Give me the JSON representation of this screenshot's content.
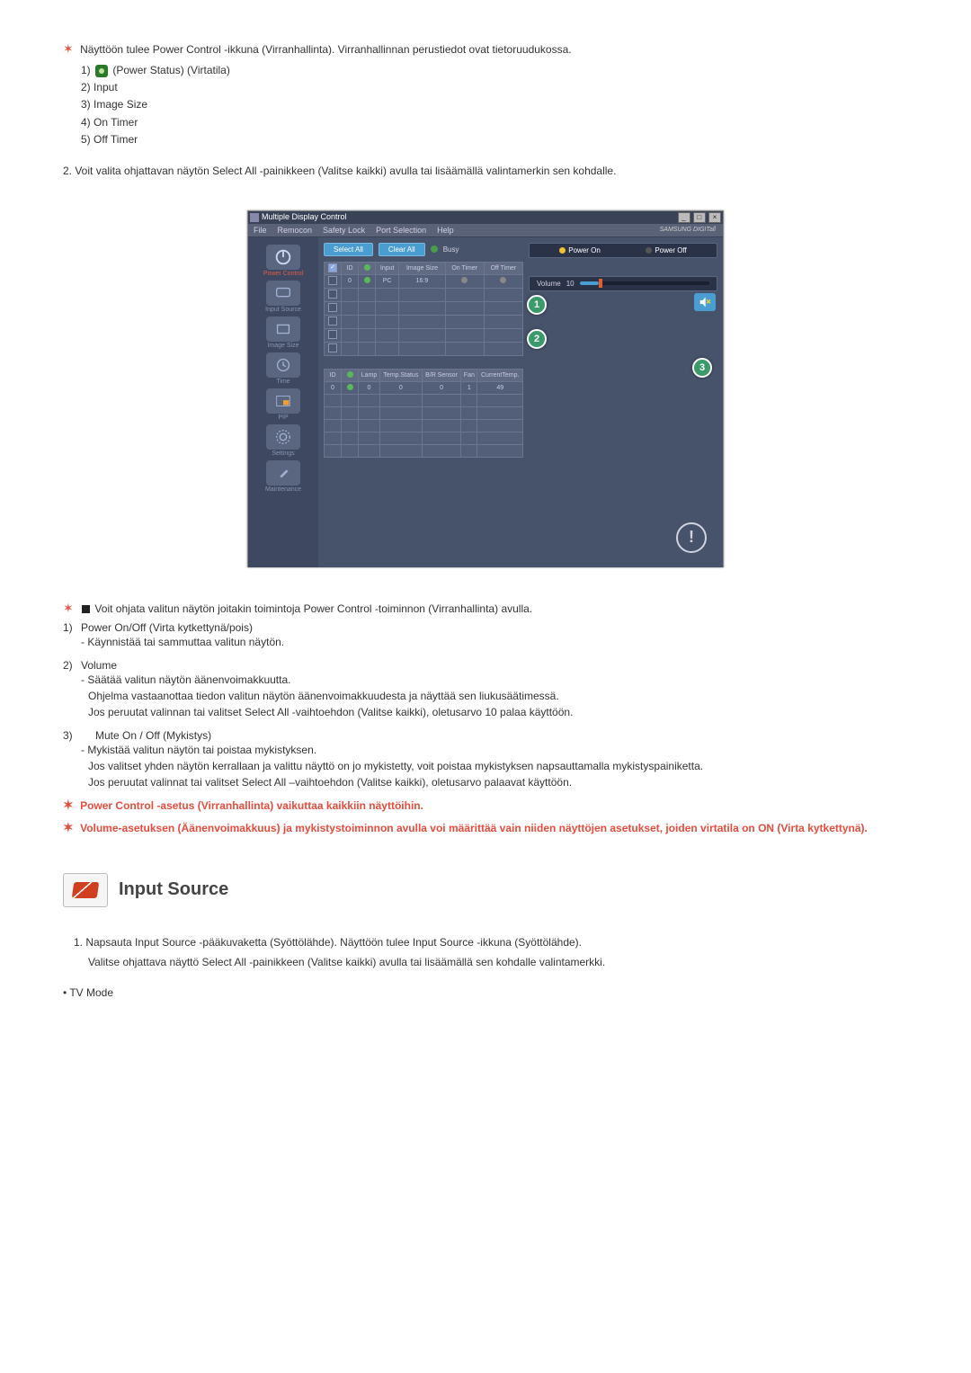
{
  "intro": {
    "line": "Näyttöön tulee Power Control -ikkuna (Virranhallinta). Virranhallinnan perustiedot ovat tietoruudukossa.",
    "items": [
      "1)  (Power Status) (Virtatila)",
      "2) Input",
      "3) Image Size",
      "4) On Timer",
      "5) Off Timer"
    ],
    "para2": "2.  Voit valita ohjattavan näytön Select All -painikkeen (Valitse kaikki) avulla tai lisäämällä valintamerkin sen kohdalle."
  },
  "app": {
    "title": "Multiple Display Control",
    "menus": [
      "File",
      "Remocon",
      "Safety Lock",
      "Port Selection",
      "Help"
    ],
    "brand": "SAMSUNG DIGITall",
    "sidebar": [
      {
        "label": "Power Control"
      },
      {
        "label": "Input Source"
      },
      {
        "label": "Image Size"
      },
      {
        "label": "Time"
      },
      {
        "label": "PIP"
      },
      {
        "label": "Settings"
      },
      {
        "label": "Maintenance"
      }
    ],
    "buttons": {
      "select_all": "Select All",
      "clear_all": "Clear All",
      "busy": "Busy"
    },
    "table1": {
      "headers": [
        "",
        "ID",
        "",
        "Input",
        "Image Size",
        "On Timer",
        "Off Timer"
      ],
      "row": [
        "",
        "0",
        "",
        "PC",
        "16:9",
        "",
        ""
      ]
    },
    "table2": {
      "headers": [
        "ID",
        "",
        "Lamp",
        "Temp.Status",
        "B/R Sensor",
        "Fan",
        "CurrentTemp."
      ],
      "row": [
        "0",
        "",
        "0",
        "0",
        "0",
        "1",
        "49"
      ]
    },
    "right": {
      "power_on": "Power On",
      "power_off": "Power Off",
      "volume_label": "Volume",
      "volume_value": "10"
    }
  },
  "bottom": {
    "lead": "Voit ohjata valitun näytön joitakin toimintoja Power Control -toiminnon (Virranhallinta) avulla.",
    "items": [
      {
        "n": "1)",
        "title": "Power On/Off (Virta kytkettynä/pois)",
        "desc": [
          "- Käynnistää tai sammuttaa valitun näytön."
        ]
      },
      {
        "n": "2)",
        "title": "Volume",
        "desc": [
          "- Säätää valitun näytön äänenvoimakkuutta.",
          "Ohjelma vastaanottaa tiedon valitun näytön äänenvoimakkuudesta ja näyttää sen liukusäätimessä.",
          "Jos peruutat valinnan tai valitset Select All -vaihtoehdon (Valitse kaikki), oletusarvo 10 palaa käyttöön."
        ]
      },
      {
        "n": "3)",
        "title": "Mute On / Off (Mykistys)",
        "desc": [
          "- Mykistää valitun näytön tai poistaa mykistyksen.",
          "Jos valitset yhden näytön kerrallaan ja valittu näyttö on jo mykistetty, voit poistaa mykistyksen napsauttamalla mykistyspainiketta.",
          "Jos peruutat valinnat tai valitset Select All –vaihtoehdon (Valitse kaikki), oletusarvo palaavat käyttöön."
        ]
      }
    ],
    "note1": "Power Control -asetus (Virranhallinta) vaikuttaa kaikkiin näyttöihin.",
    "note2": "Volume-asetuksen (Äänenvoimakkuus) ja mykistystoiminnon avulla voi määrittää vain niiden näyttöjen asetukset, joiden virtatila on ON (Virta kytkettynä)."
  },
  "section2": {
    "title": "Input Source",
    "p1": "1.  Napsauta Input Source -pääkuvaketta (Syöttölähde). Näyttöön tulee Input Source -ikkuna (Syöttölähde).",
    "p1b": "Valitse ohjattava näyttö Select All -painikkeen (Valitse kaikki) avulla tai lisäämällä sen kohdalle valintamerkki.",
    "tv": "• TV Mode"
  }
}
